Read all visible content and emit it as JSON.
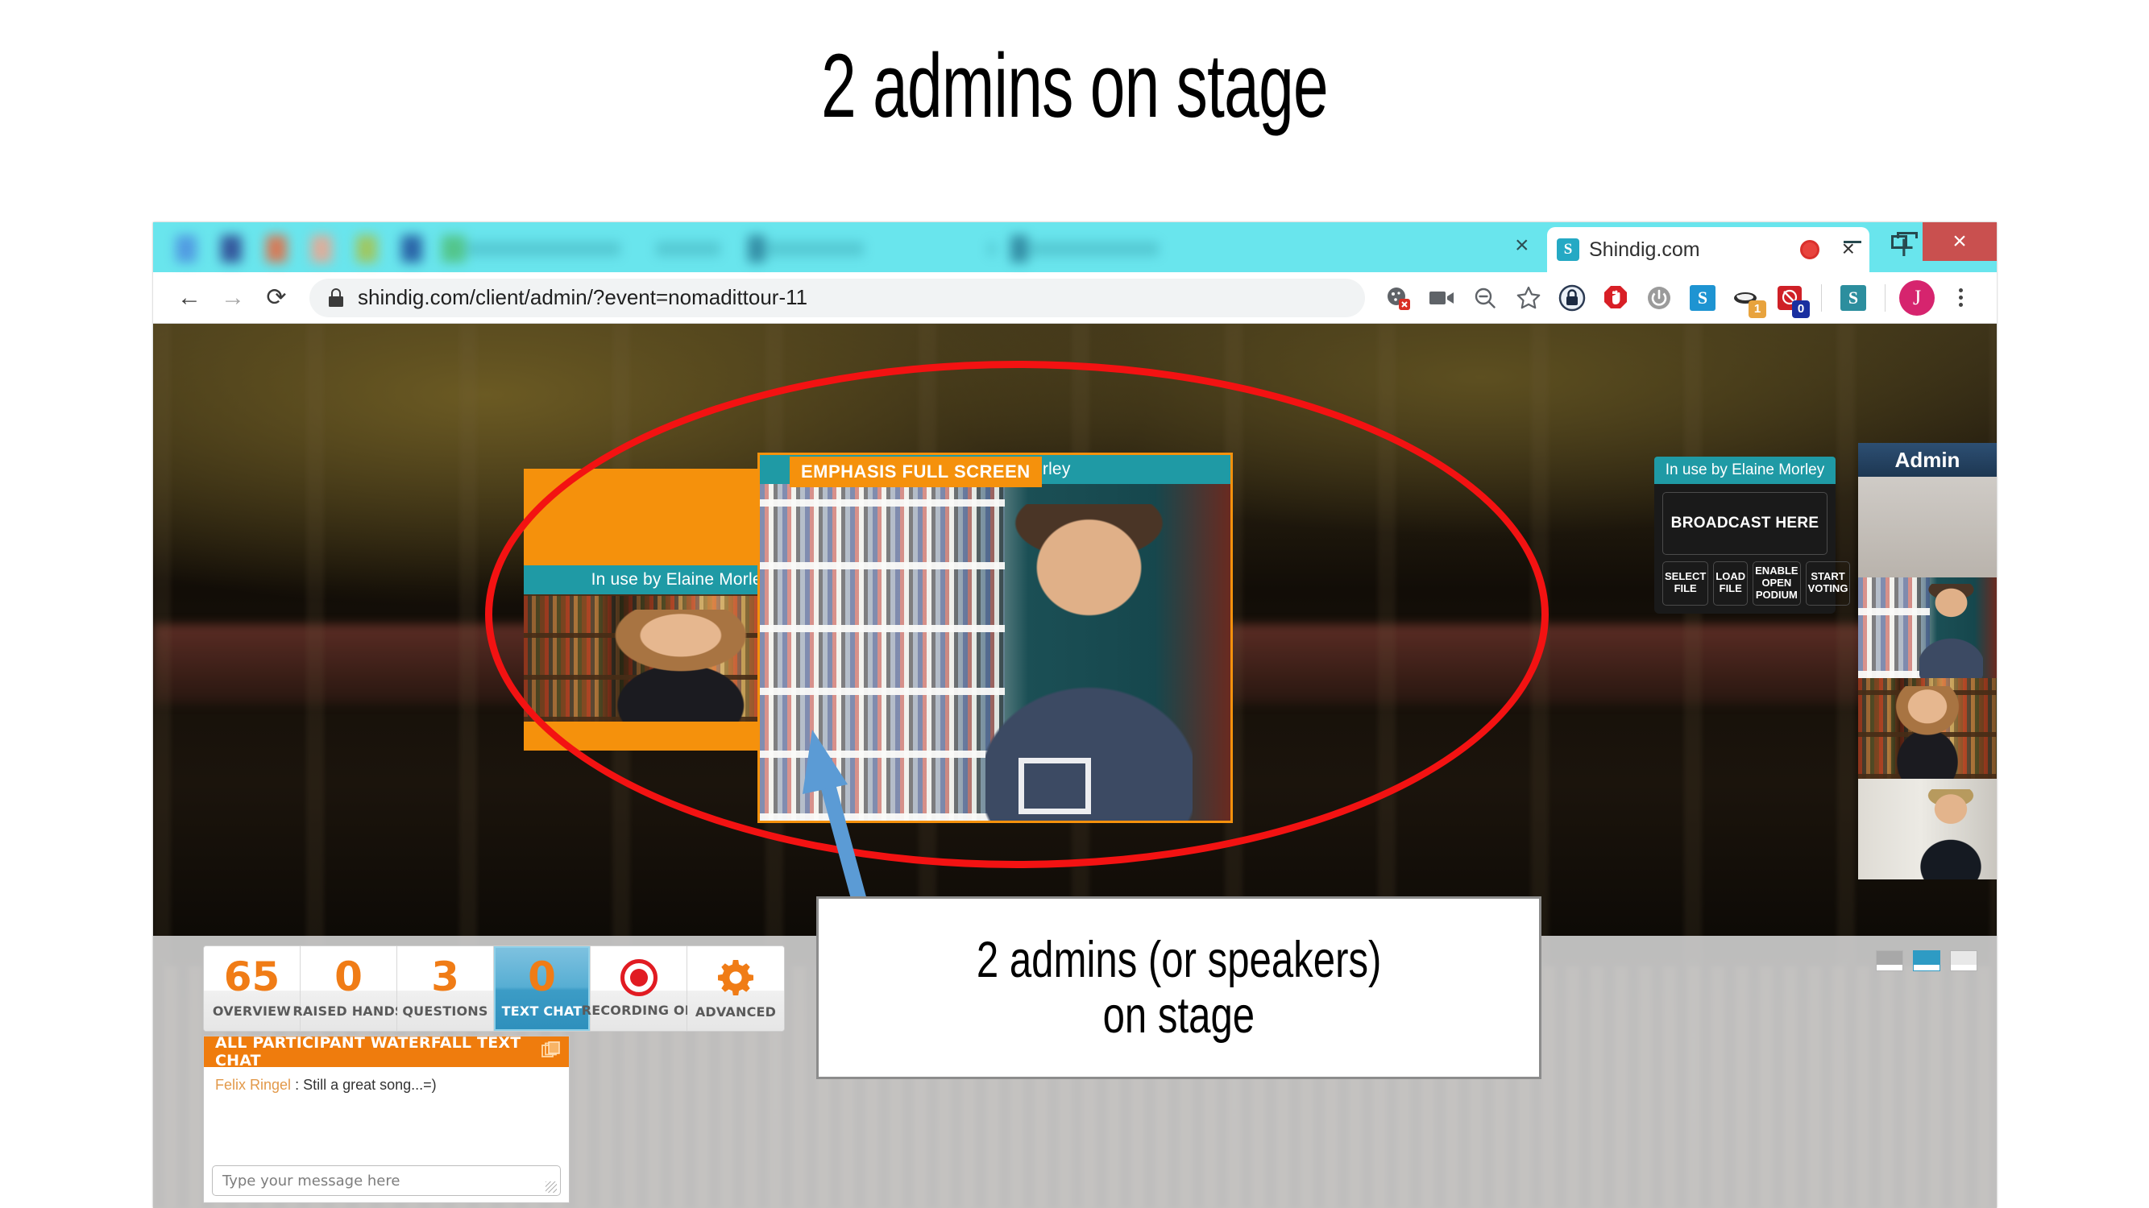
{
  "slide": {
    "title": "2 admins on stage",
    "callout_lines": [
      "2 admins (or speakers)",
      "on stage"
    ]
  },
  "browser": {
    "active_tab": {
      "title": "Shindig.com",
      "favicon_letter": "S",
      "recording_indicator": "recording-dot",
      "close_label": "×"
    },
    "redacted_tab_close": "×",
    "new_tab_label": "+",
    "window_controls": {
      "minimize": "−",
      "maximize": "❐",
      "close": "×"
    },
    "nav": {
      "back": "←",
      "forward": "→",
      "reload": "⟳"
    },
    "omnibox": {
      "lock_icon": "padlock-icon",
      "url": "shindig.com/client/admin/?event=nomadittour-11"
    },
    "toolbar_icons": [
      {
        "name": "cookie-block-icon",
        "label": ""
      },
      {
        "name": "video-camera-icon",
        "label": ""
      },
      {
        "name": "zoom-out-icon",
        "label": ""
      },
      {
        "name": "bookmark-star-icon",
        "label": ""
      }
    ],
    "extensions": [
      {
        "name": "privacy-lock-extension",
        "letter": "",
        "badge": "",
        "color": "#2b3a52"
      },
      {
        "name": "adblock-stop-hand-extension",
        "letter": "",
        "badge": "",
        "color": "#d81f26"
      },
      {
        "name": "power-toggle-extension",
        "letter": "",
        "badge": "",
        "color": "#9b9b9b"
      },
      {
        "name": "skype-extension",
        "letter": "S",
        "badge": "",
        "color": "#1e94d2"
      },
      {
        "name": "privacy-badger-extension",
        "letter": "",
        "badge": "1",
        "color": "#e8a33d"
      },
      {
        "name": "tracker-blocker-extension",
        "letter": "",
        "badge": "0",
        "color": "#cf2027"
      },
      {
        "name": "shindig-extension",
        "letter": "S",
        "badge": "",
        "color": "#2c8e9e"
      }
    ],
    "profile_avatar_letter": "J",
    "menu_icon": "kebab-menu-icon"
  },
  "stage": {
    "emphasis_tag": "EMPHASIS FULL SCREEN",
    "left_panel_header": "In use by Elaine Morley",
    "main_panel_header": "se by Elaine Morley",
    "broadcast": {
      "header": "In use by Elaine Morley",
      "broadcast_label": "BROADCAST HERE",
      "buttons": [
        "SELECT FILE",
        "LOAD FILE",
        "ENABLE OPEN PODIUM",
        "START VOTING"
      ]
    },
    "admin_sidebar": {
      "header": "Admin"
    }
  },
  "adminbar": {
    "stats": [
      {
        "value": "65",
        "label": "OVERVIEW",
        "active": false,
        "icon": ""
      },
      {
        "value": "0",
        "label": "RAISED HANDS",
        "active": false,
        "icon": ""
      },
      {
        "value": "3",
        "label": "QUESTIONS",
        "active": false,
        "icon": ""
      },
      {
        "value": "0",
        "label": "TEXT CHAT",
        "active": true,
        "icon": ""
      },
      {
        "value": "",
        "label": "RECORDING ON",
        "active": false,
        "icon": "record-dot-icon"
      },
      {
        "value": "",
        "label": "ADVANCED",
        "active": false,
        "icon": "gear-icon"
      }
    ],
    "chat": {
      "header": "ALL PARTICIPANT WATERFALL TEXT CHAT",
      "popout_icon": "popout-windows-icon",
      "messages": [
        {
          "author": "Felix Ringel",
          "separator": ":",
          "text": "Still a great song...=)"
        }
      ],
      "input_placeholder": "Type your message here"
    },
    "layout_toggles": [
      {
        "name": "layout-toggle-left",
        "selected": false
      },
      {
        "name": "layout-toggle-middle",
        "selected": true
      },
      {
        "name": "layout-toggle-right",
        "selected": false
      }
    ]
  },
  "colors": {
    "tabstrip": "#69e5ed",
    "orange": "#f5910c",
    "teal": "#1f9aa5",
    "stat_orange": "#f07c16",
    "chat_header_orange": "#ef7c0d",
    "annotation_red": "#f31212",
    "arrow_blue": "#5b9bd5",
    "close_red": "#c9504f"
  }
}
